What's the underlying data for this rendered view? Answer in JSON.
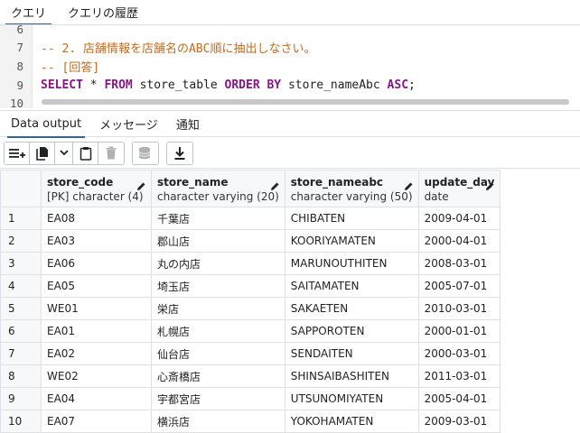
{
  "top_tabs": [
    {
      "label": "クエリ",
      "active": true
    },
    {
      "label": "クエリの履歴",
      "active": false
    }
  ],
  "editor": {
    "lines": [
      {
        "no": "6",
        "text": ""
      },
      {
        "no": "7",
        "text": "-- 2. 店舗情報を店舗名のABC順に抽出しなさい。"
      },
      {
        "no": "8",
        "text": "-- [回答]"
      },
      {
        "no": "9",
        "select": "SELECT",
        "star": " * ",
        "from": "FROM",
        "mid": " store_table ",
        "orderby": "ORDER BY",
        "col": " store_nameAbc ",
        "asc": "ASC",
        "end": ";"
      },
      {
        "no": "10",
        "text": ""
      }
    ]
  },
  "result_tabs": [
    {
      "label": "Data output",
      "active": true
    },
    {
      "label": "メッセージ",
      "active": false
    },
    {
      "label": "通知",
      "active": false
    }
  ],
  "toolbar_icons": [
    "add-row-icon",
    "copy-icon",
    "chevron-down-icon",
    "paste-icon",
    "delete-icon",
    "save-data-icon",
    "download-icon"
  ],
  "grid": {
    "columns": [
      {
        "name": "store_code",
        "type": "[PK] character (4)"
      },
      {
        "name": "store_name",
        "type": "character varying (20)"
      },
      {
        "name": "store_nameabc",
        "type": "character varying (50)"
      },
      {
        "name": "update_day",
        "type": "date"
      }
    ],
    "rows": [
      {
        "n": "1",
        "c": [
          "EA08",
          "千葉店",
          "CHIBATEN",
          "2009-04-01"
        ]
      },
      {
        "n": "2",
        "c": [
          "EA03",
          "郡山店",
          "KOORIYAMATEN",
          "2000-04-01"
        ]
      },
      {
        "n": "3",
        "c": [
          "EA06",
          "丸の内店",
          "MARUNOUTHITEN",
          "2008-03-01"
        ]
      },
      {
        "n": "4",
        "c": [
          "EA05",
          "埼玉店",
          "SAITAMATEN",
          "2005-07-01"
        ]
      },
      {
        "n": "5",
        "c": [
          "WE01",
          "栄店",
          "SAKAETEN",
          "2010-03-01"
        ]
      },
      {
        "n": "6",
        "c": [
          "EA01",
          "札幌店",
          "SAPPOROTEN",
          "2000-01-01"
        ]
      },
      {
        "n": "7",
        "c": [
          "EA02",
          "仙台店",
          "SENDAITEN",
          "2000-03-01"
        ]
      },
      {
        "n": "8",
        "c": [
          "WE02",
          "心斎橋店",
          "SHINSAIBASHITEN",
          "2011-03-01"
        ]
      },
      {
        "n": "9",
        "c": [
          "EA04",
          "宇都宮店",
          "UTSUNOMIYATEN",
          "2005-04-01"
        ]
      },
      {
        "n": "10",
        "c": [
          "EA07",
          "横浜店",
          "YOKOHAMATEN",
          "2009-03-01"
        ]
      }
    ]
  },
  "colors": {
    "accent": "#326690",
    "sql_keyword": "#8a1585",
    "sql_comment": "#c56b1c"
  }
}
